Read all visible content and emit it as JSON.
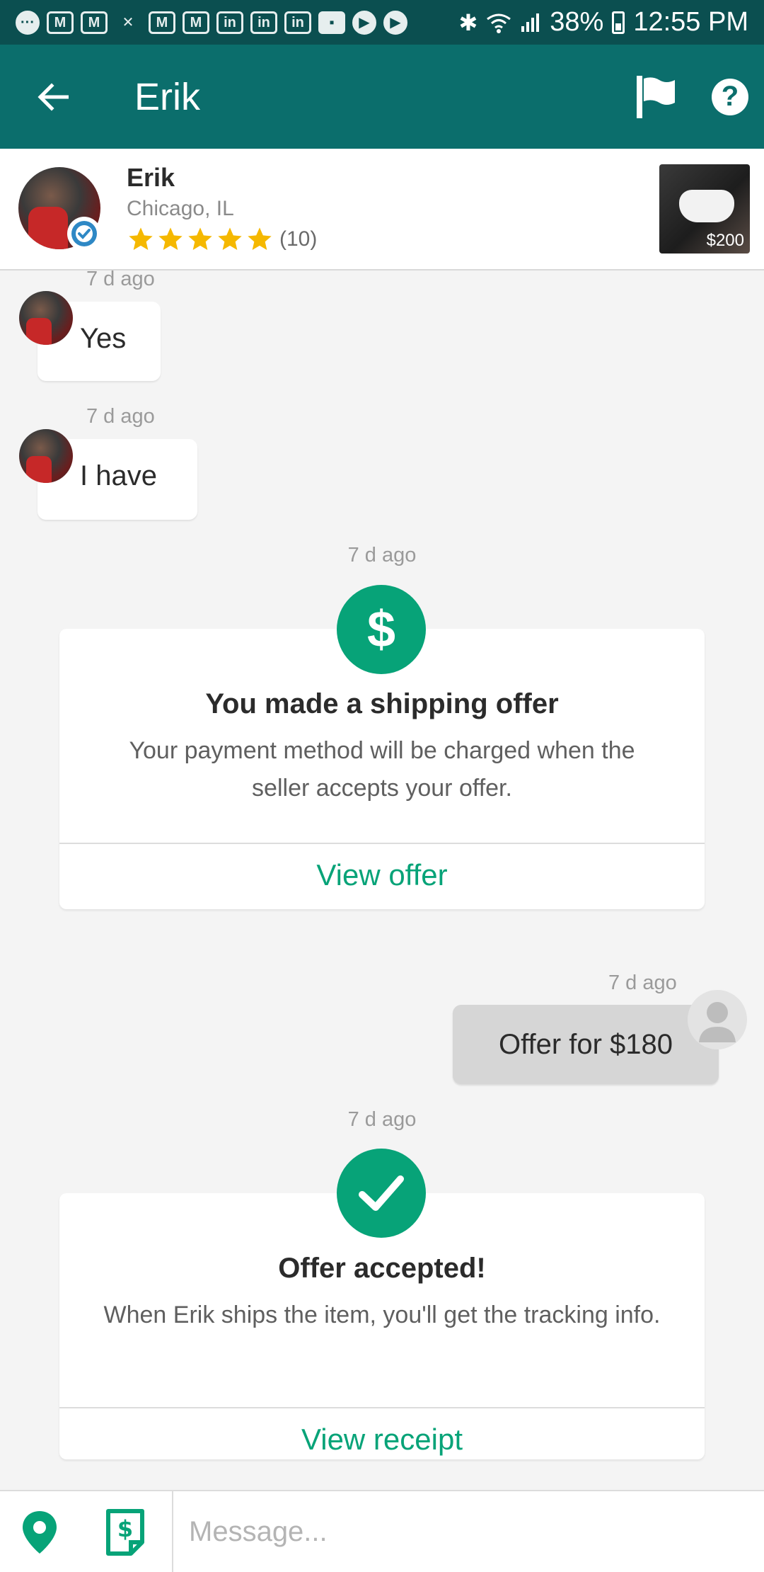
{
  "status_bar": {
    "battery": "38%",
    "time": "12:55 PM",
    "notification_icons": [
      "messenger",
      "gmail",
      "gmail",
      "missed-call",
      "gmail",
      "gmail",
      "linkedin",
      "linkedin",
      "linkedin",
      "chat",
      "youtube",
      "youtube"
    ],
    "system_icons": [
      "bluetooth",
      "wifi",
      "signal",
      "battery"
    ]
  },
  "app_bar": {
    "title": "Erik",
    "icons": [
      "back-arrow",
      "flag",
      "help"
    ]
  },
  "seller": {
    "name": "Erik",
    "location": "Chicago, IL",
    "rating_stars": 5,
    "rating_count": "(10)",
    "verified": true,
    "item_price": "$200"
  },
  "messages": {
    "msg1": {
      "time": "7 d ago",
      "text": "Yes"
    },
    "msg2": {
      "time": "7 d ago",
      "text": "I have"
    },
    "offer_card": {
      "time": "7 d ago",
      "icon": "dollar",
      "title": "You made a shipping offer",
      "body": "Your payment method will be charged when the seller accepts your offer.",
      "link": "View offer"
    },
    "outgoing": {
      "time": "7 d ago",
      "text": "Offer for $180"
    },
    "accepted_card": {
      "time": "7 d ago",
      "icon": "checkmark",
      "title": "Offer accepted!",
      "body": "When Erik ships the item, you'll get the tracking info.",
      "link": "View receipt"
    }
  },
  "composer": {
    "placeholder": "Message...",
    "icons": [
      "location-pin",
      "payment"
    ]
  },
  "colors": {
    "status_bar": "#0b4f50",
    "app_bar": "#0b6e6c",
    "accent": "#07a378",
    "star": "#f5b800",
    "background": "#f4f4f4"
  }
}
